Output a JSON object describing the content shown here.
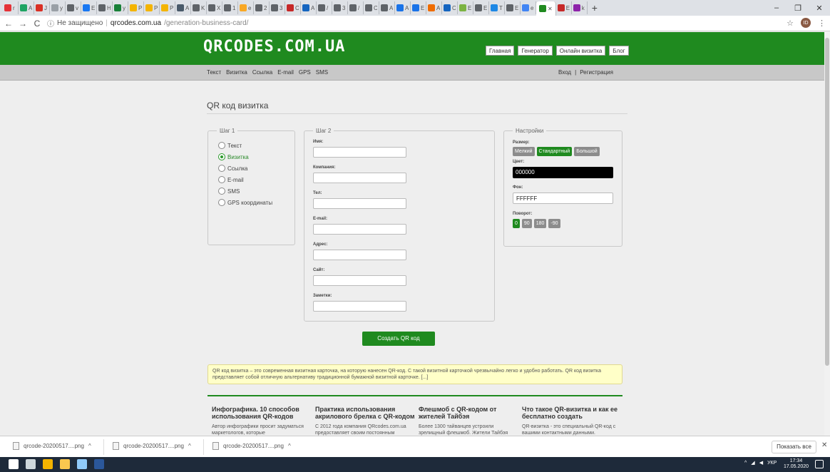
{
  "browser": {
    "tabs": [
      {
        "icon": "ebay-icon",
        "color": "#e53238",
        "label": "r"
      },
      {
        "icon": "drive-icon",
        "color": "#1fa463",
        "label": "A"
      },
      {
        "icon": "gmail-icon",
        "color": "#d93025",
        "label": "J"
      },
      {
        "icon": "page-icon",
        "color": "#9aa0a6",
        "label": "y"
      },
      {
        "icon": "globe-icon",
        "color": "#5f6368",
        "label": "v"
      },
      {
        "icon": "facebook-icon",
        "color": "#1877f2",
        "label": "E"
      },
      {
        "icon": "globe-icon",
        "color": "#5f6368",
        "label": "H"
      },
      {
        "icon": "sheets-icon",
        "color": "#188038",
        "label": "y"
      },
      {
        "icon": "bookmark-icon",
        "color": "#f4b400",
        "label": "P"
      },
      {
        "icon": "bookmark-icon",
        "color": "#f4b400",
        "label": "P"
      },
      {
        "icon": "bookmark-icon",
        "color": "#f4b400",
        "label": "P"
      },
      {
        "icon": "app-icon",
        "color": "#4a5a6a",
        "label": "A"
      },
      {
        "icon": "globe-icon",
        "color": "#5f6368",
        "label": "K"
      },
      {
        "icon": "globe-icon",
        "color": "#5f6368",
        "label": "X"
      },
      {
        "icon": "globe-icon",
        "color": "#5f6368",
        "label": "1"
      },
      {
        "icon": "sun-icon",
        "color": "#f9a825",
        "label": "e"
      },
      {
        "icon": "globe-icon",
        "color": "#5f6368",
        "label": "2"
      },
      {
        "icon": "circle-icon",
        "color": "#5f6368",
        "label": "3"
      },
      {
        "icon": "pdf-icon",
        "color": "#c62828",
        "label": "C"
      },
      {
        "icon": "app-icon",
        "color": "#1565c0",
        "label": "A"
      },
      {
        "icon": "globe-icon",
        "color": "#5f6368",
        "label": "/"
      },
      {
        "icon": "globe-icon",
        "color": "#5f6368",
        "label": "3"
      },
      {
        "icon": "globe-icon",
        "color": "#5f6368",
        "label": "/"
      },
      {
        "icon": "globe-icon",
        "color": "#5f6368",
        "label": "C"
      },
      {
        "icon": "globe-icon",
        "color": "#5f6368",
        "label": "A"
      },
      {
        "icon": "doc-icon",
        "color": "#1a73e8",
        "label": "A"
      },
      {
        "icon": "app-icon",
        "color": "#1a73e8",
        "label": "E"
      },
      {
        "icon": "app-icon",
        "color": "#ef6c00",
        "label": "A"
      },
      {
        "icon": "app-icon",
        "color": "#1565c0",
        "label": "C"
      },
      {
        "icon": "chart-icon",
        "color": "#7cb342",
        "label": "E"
      },
      {
        "icon": "globe-icon",
        "color": "#5f6368",
        "label": "E"
      },
      {
        "icon": "app-icon",
        "color": "#1e88e5",
        "label": "T"
      },
      {
        "icon": "globe-icon",
        "color": "#5f6368",
        "label": "E"
      },
      {
        "icon": "google-icon",
        "color": "#4285f4",
        "label": "e"
      },
      {
        "icon": "qr-icon",
        "color": "#1f8a1f",
        "label": "",
        "active": true
      },
      {
        "icon": "app-icon",
        "color": "#c62828",
        "label": "E"
      },
      {
        "icon": "app-icon",
        "color": "#8e24aa",
        "label": "k"
      }
    ],
    "new_tab": "+",
    "window_controls": {
      "minimize": "–",
      "restore": "❐",
      "close": "✕"
    },
    "address": {
      "security": "Не защищено",
      "host": "qrcodes.com.ua",
      "path": "/generation-business-card/"
    },
    "profile_initials": "ID"
  },
  "site": {
    "logo": "QRCODES.COM.UA",
    "top_nav": [
      "Главная",
      "Генератор",
      "Онлайн визитка",
      "Блог"
    ],
    "sub_nav": [
      "Текст",
      "Визитка",
      "Ссылка",
      "E-mail",
      "GPS",
      "SMS"
    ],
    "auth": {
      "login": "Вход",
      "sep": "|",
      "register": "Регистрация"
    },
    "page_title": "QR код визитка",
    "step1": {
      "legend": "Шаг 1",
      "options": [
        {
          "label": "Текст",
          "selected": false
        },
        {
          "label": "Визитка",
          "selected": true
        },
        {
          "label": "Ссылка",
          "selected": false
        },
        {
          "label": "E-mail",
          "selected": false
        },
        {
          "label": "SMS",
          "selected": false
        },
        {
          "label": "GPS координаты",
          "selected": false
        }
      ]
    },
    "step2": {
      "legend": "Шаг 2",
      "fields": [
        {
          "label": "Имя:",
          "value": ""
        },
        {
          "label": "Компания:",
          "value": ""
        },
        {
          "label": "Тел:",
          "value": ""
        },
        {
          "label": "E-mail:",
          "value": ""
        },
        {
          "label": "Адрес:",
          "value": ""
        },
        {
          "label": "Сайт:",
          "value": ""
        },
        {
          "label": "Заметки:",
          "value": ""
        }
      ]
    },
    "settings": {
      "legend": "Настройки",
      "size_label": "Размер:",
      "sizes": [
        {
          "label": "Мелкий",
          "selected": false
        },
        {
          "label": "Стандартный",
          "selected": true
        },
        {
          "label": "Большой",
          "selected": false
        }
      ],
      "color_label": "Цвет:",
      "color_value": "000000",
      "bg_label": "Фон:",
      "bg_value": "FFFFFF",
      "rotation_label": "Поворот:",
      "rotations": [
        {
          "label": "0",
          "selected": true
        },
        {
          "label": "90",
          "selected": false
        },
        {
          "label": "180",
          "selected": false
        },
        {
          "label": "-90",
          "selected": false
        }
      ]
    },
    "create_button": "Создать QR код",
    "info_text": "QR код визитка – это современная визитная карточка, на которую нанесен QR-код. С такой визитной карточкой чрезвычайно легко и удобно работать. QR код визитка представляет собой отличную альтернативу традиционной бумажной визитной карточке. [...]",
    "articles": [
      {
        "title": "Инфографика. 10 способов использования QR-кодов",
        "text": "Автор инфографики просит задуматься маркетологов, которые"
      },
      {
        "title": "Практика использования акрилового брелка с QR-кодом",
        "text": "С 2012 года компания QRcodes.com.ua предоставляет своим постоянным"
      },
      {
        "title": "Флешмоб с QR-кодом от жителей Тайбэя",
        "text": "Более 1300 тайванцев устроили зрелищный флешмоб. Жители Тайбэя"
      },
      {
        "title": "Что такое QR-визитка и как ее бесплатно создать",
        "text": "QR-визитка - это специальный QR-код с вашими контактными данными."
      }
    ]
  },
  "downloads": {
    "items": [
      {
        "name": "qrcode-20200517....png",
        "caret": "^"
      },
      {
        "name": "qrcode-20200517....png",
        "caret": "^"
      },
      {
        "name": "qrcode-20200517....png",
        "caret": "^"
      }
    ],
    "show_all": "Показать все",
    "close": "✕"
  },
  "taskbar": {
    "icons": [
      {
        "name": "start-icon",
        "color": "#ffffff"
      },
      {
        "name": "task-view-icon",
        "color": "#cfd8dc"
      },
      {
        "name": "chrome-icon",
        "color": "#f4b400"
      },
      {
        "name": "explorer-icon",
        "color": "#f9c74f"
      },
      {
        "name": "paint-icon",
        "color": "#90caf9"
      },
      {
        "name": "word-icon",
        "color": "#2b579a"
      }
    ],
    "lang": "УКР",
    "time": "17:34",
    "date": "17.05.2020"
  }
}
